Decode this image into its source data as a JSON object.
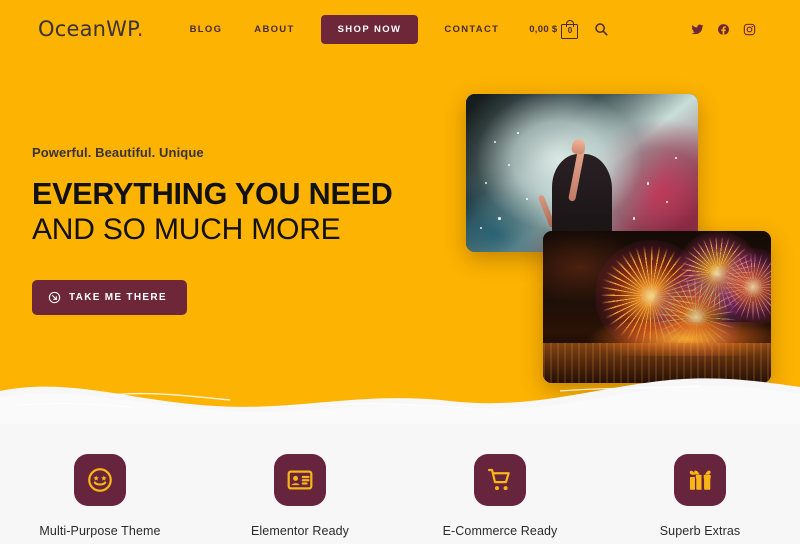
{
  "theme": {
    "hero_bg": "#FDB302",
    "accent_maroon": "#6E2639",
    "feature_icon_bg": "#66253C",
    "icon_yellow": "#F9B415",
    "section_bg": "#F7F7F7",
    "heading_color": "#111111"
  },
  "header": {
    "logo_text": "OceanWP",
    "logo_dot": ".",
    "nav": [
      {
        "label": "BLOG",
        "name": "nav-link-blog"
      },
      {
        "label": "ABOUT",
        "name": "nav-link-about"
      }
    ],
    "shop_now_label": "SHOP NOW",
    "nav_after": [
      {
        "label": "CONTACT",
        "name": "nav-link-contact"
      }
    ],
    "cart": {
      "amount": "0,00 $",
      "count": "0",
      "icon": "shopping-bag-icon"
    },
    "search_icon": "search-icon",
    "socials": [
      {
        "name": "twitter-icon",
        "label": "Twitter"
      },
      {
        "name": "facebook-icon",
        "label": "Facebook"
      },
      {
        "name": "instagram-icon",
        "label": "Instagram"
      }
    ]
  },
  "hero": {
    "eyebrow": "Powerful. Beautiful. Unique",
    "heading_bold": "EVERYTHING YOU NEED",
    "heading_light": "AND SO MUCH MORE",
    "cta_label": "TAKE ME THERE",
    "cta_icon": "arrow-circle-icon",
    "images": [
      {
        "name": "hero-image-smoke",
        "alt": "Person raising arm in colored smoke"
      },
      {
        "name": "hero-image-fireworks",
        "alt": "Fireworks over water at night"
      }
    ]
  },
  "features": [
    {
      "label": "Multi-Purpose Theme",
      "icon": "star-struck-smiley-icon",
      "name": "feature-multi-purpose-theme"
    },
    {
      "label": "Elementor Ready",
      "icon": "id-card-icon",
      "name": "feature-elementor-ready"
    },
    {
      "label": "E-Commerce Ready",
      "icon": "shopping-cart-icon",
      "name": "feature-ecommerce-ready"
    },
    {
      "label": "Superb Extras",
      "icon": "gift-icon",
      "name": "feature-superb-extras"
    }
  ]
}
